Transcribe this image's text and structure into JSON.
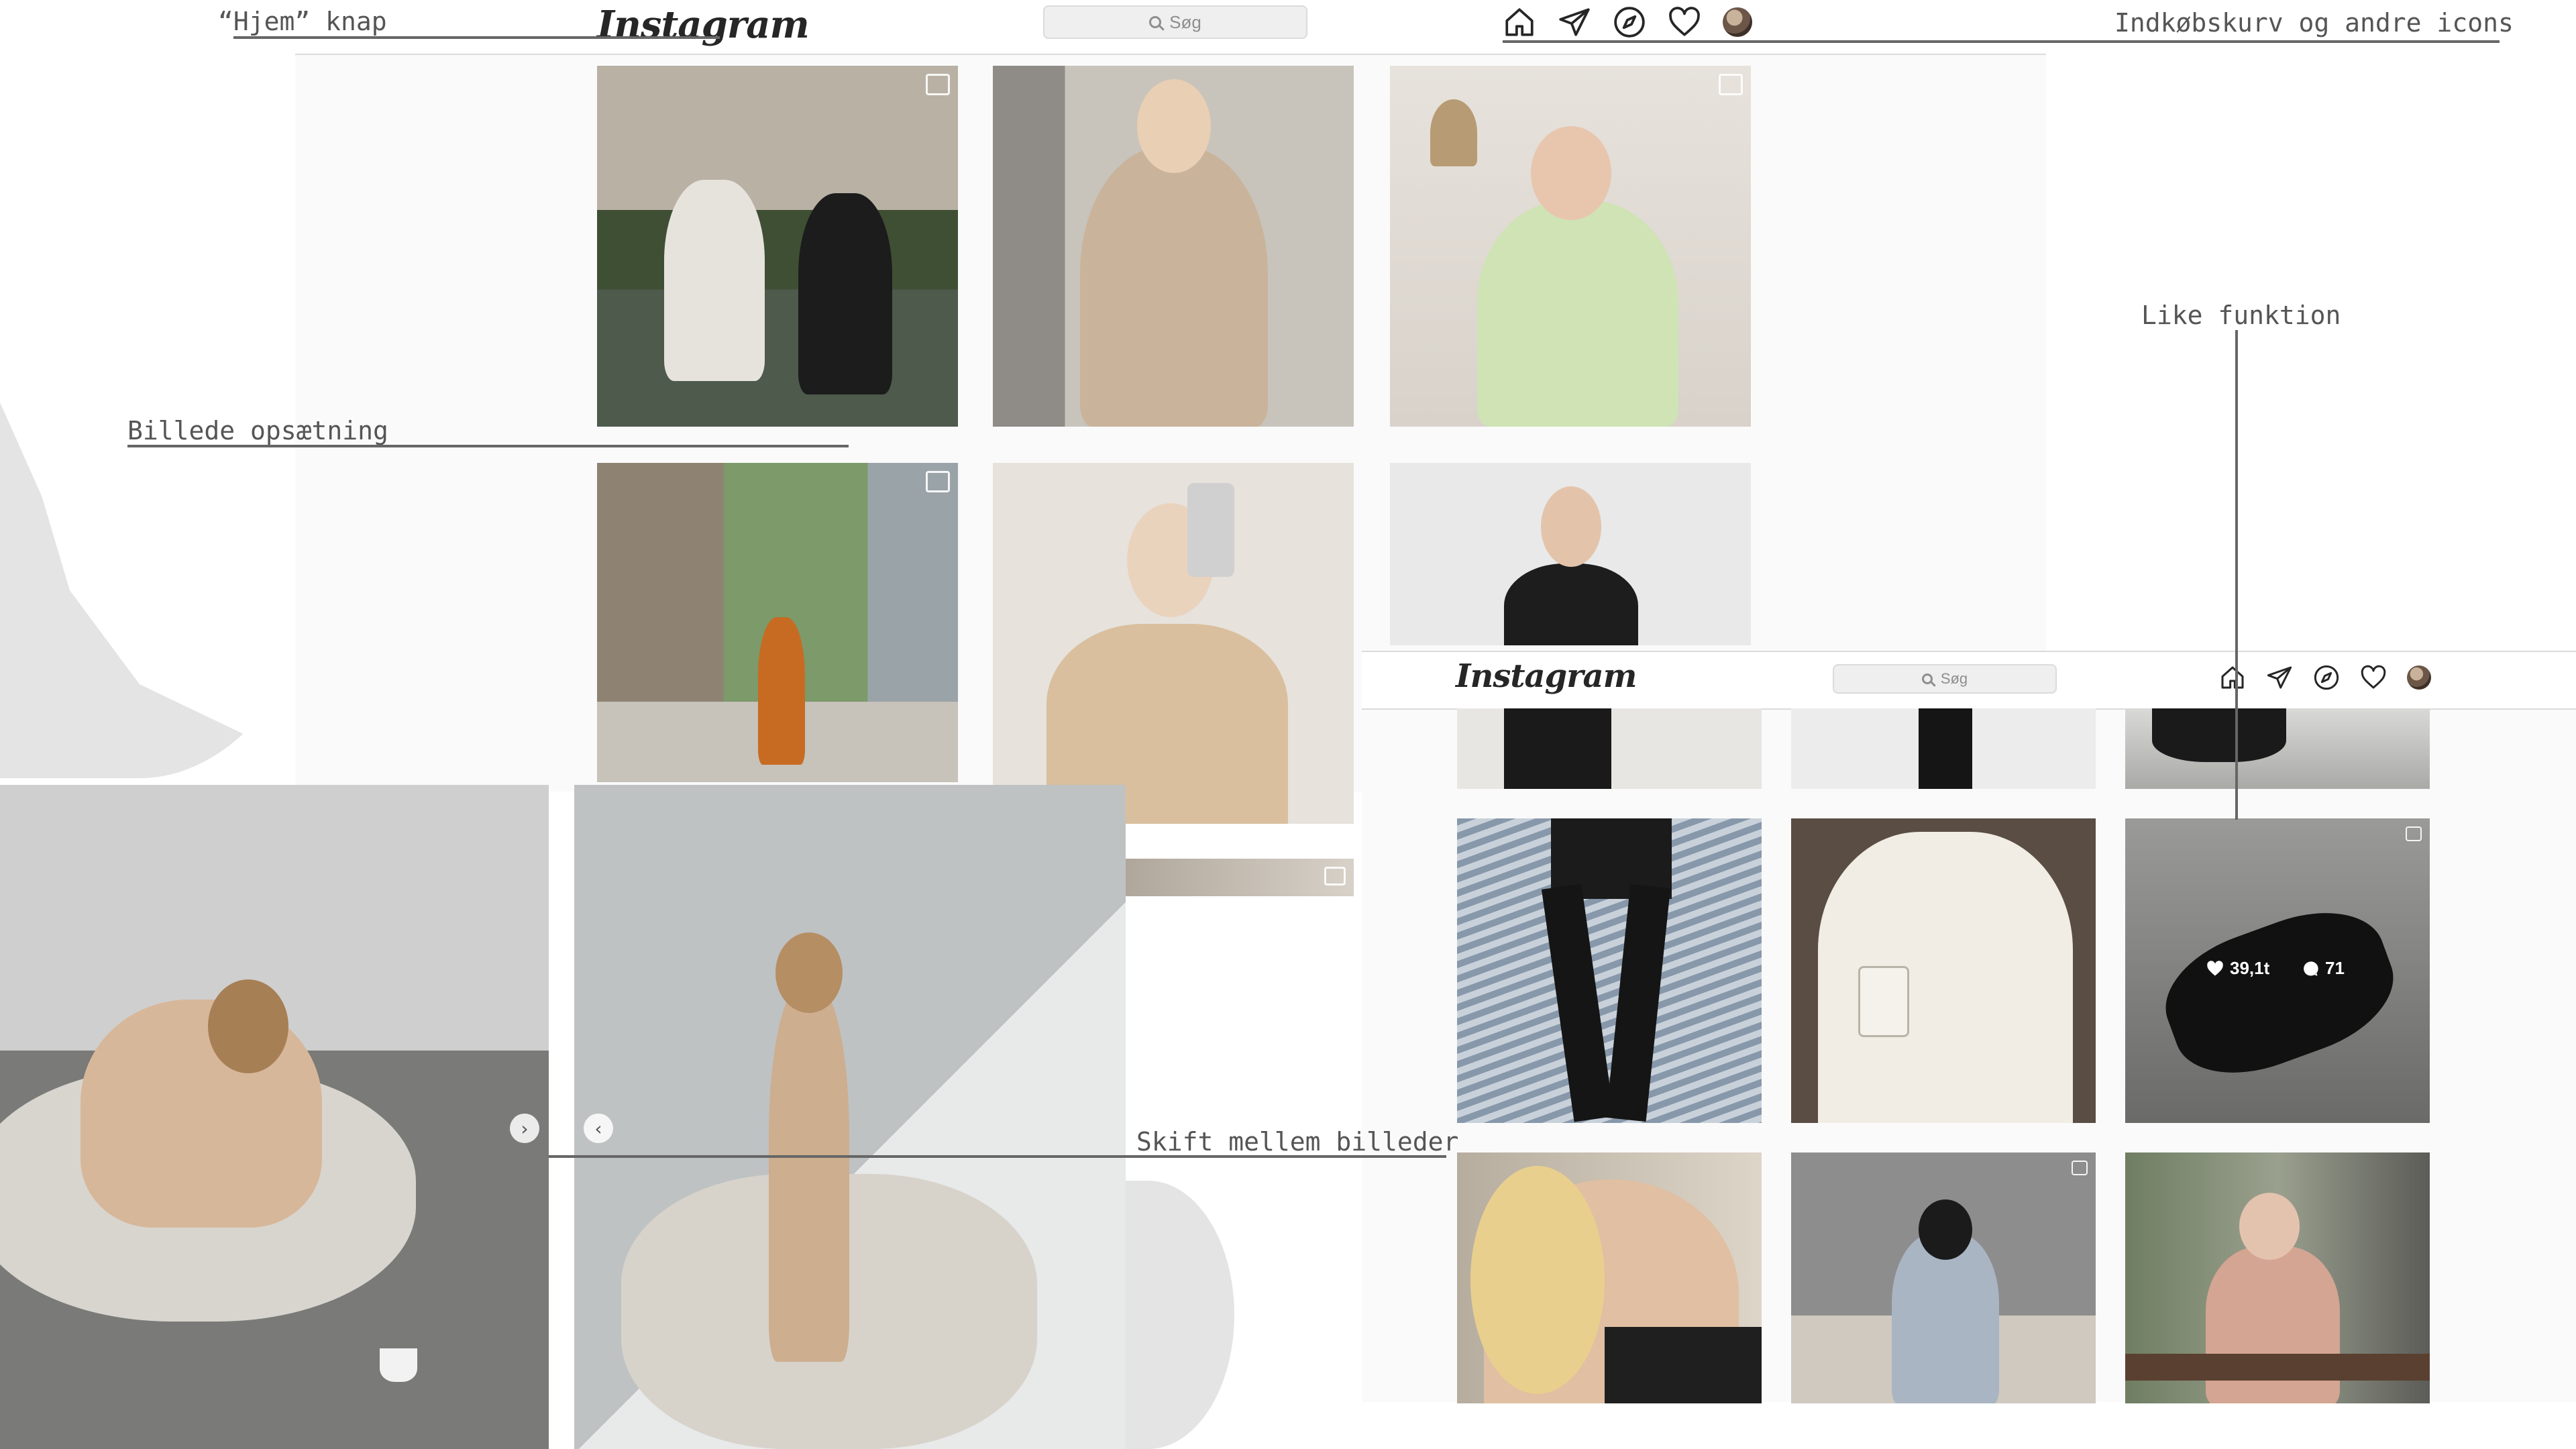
{
  "annotations": {
    "home_button": "“Hjem” knap",
    "cart_icons": "Indkøbskurv og andre icons",
    "like_function": "Like funktion",
    "image_layout": "Billede opsætning",
    "switch_images": "Skift mellem billeder"
  },
  "top_window": {
    "logo": "Instagram",
    "search_placeholder": "Søg",
    "nav_icons": [
      "home-icon",
      "direct-message-icon",
      "explore-compass-icon",
      "heart-icon",
      "profile-avatar"
    ]
  },
  "second_window": {
    "logo": "Instagram",
    "search_placeholder": "Søg",
    "nav_icons": [
      "home-icon",
      "direct-message-icon",
      "explore-compass-icon",
      "heart-icon",
      "profile-avatar"
    ],
    "hover_stats": {
      "likes": "39,1t",
      "comments": "71"
    }
  },
  "colors": {
    "accent_text": "#262626",
    "panel_bg": "#fafafa",
    "border": "#dbdbdb",
    "annotation_line": "#666666"
  }
}
